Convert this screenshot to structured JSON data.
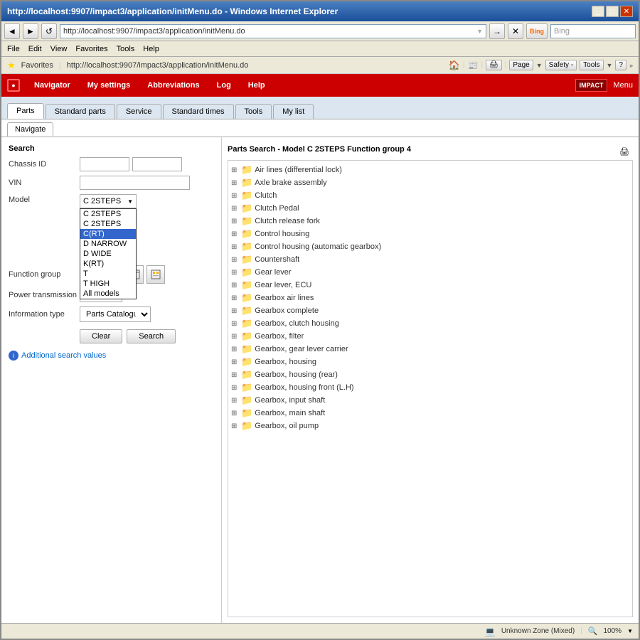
{
  "browser": {
    "title": "http://localhost:9907/impact3/application/initMenu.do - Windows Internet Explorer",
    "address": "http://localhost:9907/impact3/application/initMenu.do",
    "search_placeholder": "Bing",
    "menu_items": [
      "File",
      "Edit",
      "View",
      "Favorites",
      "Tools",
      "Help"
    ],
    "favorites_label": "Favorites",
    "favorites_url": "http://localhost:9907/impact3/application/initMenu.do",
    "page_label": "Page",
    "safety_label": "Safety -",
    "tools_label": "Tools",
    "help_label": "?"
  },
  "app_navbar": {
    "items": [
      "Navigator",
      "My settings",
      "Abbreviations",
      "Log",
      "Help"
    ],
    "logo_text": "IMPACT",
    "menu_text": "Menu"
  },
  "main_tabs": {
    "tabs": [
      "Parts",
      "Standard parts",
      "Service",
      "Standard times",
      "Tools",
      "My list"
    ],
    "active": "Parts"
  },
  "navigate_tab": {
    "label": "Navigate",
    "active": true
  },
  "search_form": {
    "title": "Search",
    "chassis_id_label": "Chassis ID",
    "vin_label": "VIN",
    "model_label": "Model",
    "function_group_label": "Function group",
    "power_transmission_label": "Power transmission",
    "information_type_label": "Information type",
    "chassis_id_value": "",
    "vin_value": "",
    "model_selected": "C 2STEPS",
    "model_options": [
      "C 2STEPS",
      "C 2STEPS",
      "C(RT)",
      "D NARROW",
      "D WIDE",
      "K(RT)",
      "T",
      "T HIGH",
      "All models"
    ],
    "model_dropdown_visible": true,
    "info_type_value": "Parts Catalogue",
    "clear_label": "Clear",
    "search_label": "Search",
    "additional_link": "Additional search values"
  },
  "parts_panel": {
    "title": "Parts Search - Model C 2STEPS Function group 4",
    "items": [
      "Air lines (differential lock)",
      "Axle brake assembly",
      "Clutch",
      "Clutch Pedal",
      "Clutch release fork",
      "Control housing",
      "Control housing (automatic gearbox)",
      "Countershaft",
      "Gear lever",
      "Gear lever, ECU",
      "Gearbox air lines",
      "Gearbox complete",
      "Gearbox, clutch housing",
      "Gearbox, filter",
      "Gearbox, gear lever carrier",
      "Gearbox, housing",
      "Gearbox, housing (rear)",
      "Gearbox, housing front (L.H)",
      "Gearbox, input shaft",
      "Gearbox, main shaft",
      "Gearbox, oil pump"
    ]
  },
  "status_bar": {
    "zone_label": "Unknown Zone (Mixed)",
    "zoom_label": "100%"
  },
  "icons": {
    "back": "◄",
    "forward": "►",
    "refresh": "↺",
    "stop": "✕",
    "go": "→",
    "folder": "📁",
    "expander": "⊞",
    "info": "i",
    "print": "🖨",
    "expand": "+",
    "search_icon": "🔍",
    "earth": "🌐",
    "lock": "🔒",
    "chevron": "▼",
    "nav_back": "⟨",
    "nav_fwd": "⟩"
  }
}
